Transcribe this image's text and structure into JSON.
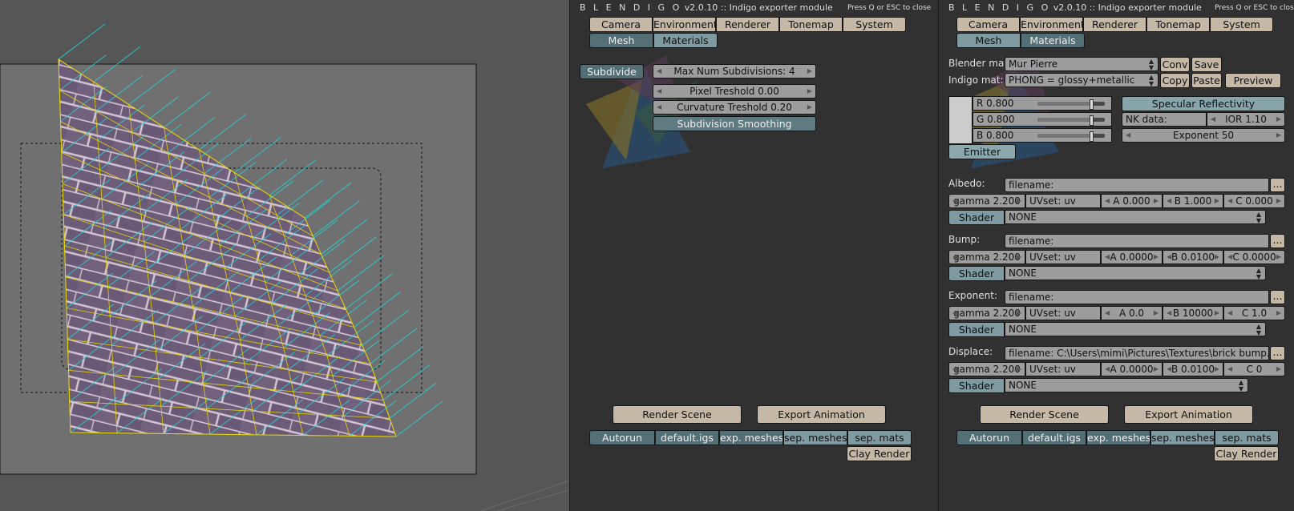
{
  "header": {
    "brand": "B L E N D I G O",
    "version": "v2.0.10",
    "separator": "::",
    "module": "Indigo exporter module",
    "hint": "Press Q or ESC to close"
  },
  "tabs": [
    "Camera",
    "Environment",
    "Renderer",
    "Tonemap",
    "System"
  ],
  "subtabs": [
    "Mesh",
    "Materials"
  ],
  "mesh": {
    "subdivide": "Subdivide",
    "max_subdivisions": "Max Num Subdivisions: 4",
    "pixel_treshold": "Pixel Treshold 0.00",
    "curvature_treshold": "Curvature Treshold 0.20",
    "subdivision_smoothing": "Subdivision Smoothing"
  },
  "footer": {
    "render_scene": "Render Scene",
    "export_animation": "Export Animation",
    "autorun": "Autorun",
    "default_igs": "default.igs",
    "exp_meshes": "exp. meshes",
    "sep_meshes": "sep. meshes",
    "sep_mats": "sep. mats",
    "clay_render": "Clay Render"
  },
  "materials": {
    "blender_mat_label": "Blender mat:",
    "blender_mat_value": "Mur Pierre",
    "conv": "Conv",
    "save": "Save",
    "indigo_mat_label": "Indigo mat:",
    "indigo_mat_value": "PHONG = glossy+metallic",
    "copy": "Copy",
    "paste": "Paste",
    "preview": "Preview",
    "r": "R 0.800",
    "g": "G 0.800",
    "b": "B 0.800",
    "rgb_level": 0.8,
    "swatch_color": "#cccccc",
    "specular_reflectivity": "Specular Reflectivity",
    "nk_data": "NK data:",
    "ior": "IOR 1.10",
    "exponent_value": "Exponent 50",
    "emitter": "Emitter",
    "filename_more": "...",
    "shader_label": "Shader",
    "sections": [
      {
        "label": "Albedo:",
        "filename": "filename:",
        "gamma": "gamma 2.200",
        "uvset": "UVset: uv",
        "a": "A 0.000",
        "b": "B 1.000",
        "c": "C 0.000",
        "shader": "NONE"
      },
      {
        "label": "Bump:",
        "filename": "filename:",
        "gamma": "gamma 2.200",
        "uvset": "UVset: uv",
        "a": "A 0.0000",
        "b": "B 0.0100",
        "c": "C 0.0000",
        "shader": "NONE"
      },
      {
        "label": "Exponent:",
        "filename": "filename:",
        "gamma": "gamma 2.200",
        "uvset": "UVset: uv",
        "a": "A 0.0",
        "b": "B 10000",
        "c": "C 1.0",
        "shader": "NONE"
      },
      {
        "label": "Displace:",
        "filename": "filename: C:\\Users\\mimi\\Pictures\\Textures\\brick bump.png",
        "gamma": "gamma 2.200",
        "uvset": "UVset: uv",
        "a": "A 0.0000",
        "b": "B 0.0100",
        "c": "C 0",
        "shader": "NONE"
      }
    ]
  },
  "colors": {
    "viewport_bg": "#565656",
    "panel_bg": "#313131",
    "button": "#c6b8a6",
    "toggle": "#7f9aa0",
    "toggle_active": "#546e75",
    "field": "#9d9d9d",
    "wire": "#e5d400",
    "normals": "#1fd6d6"
  }
}
